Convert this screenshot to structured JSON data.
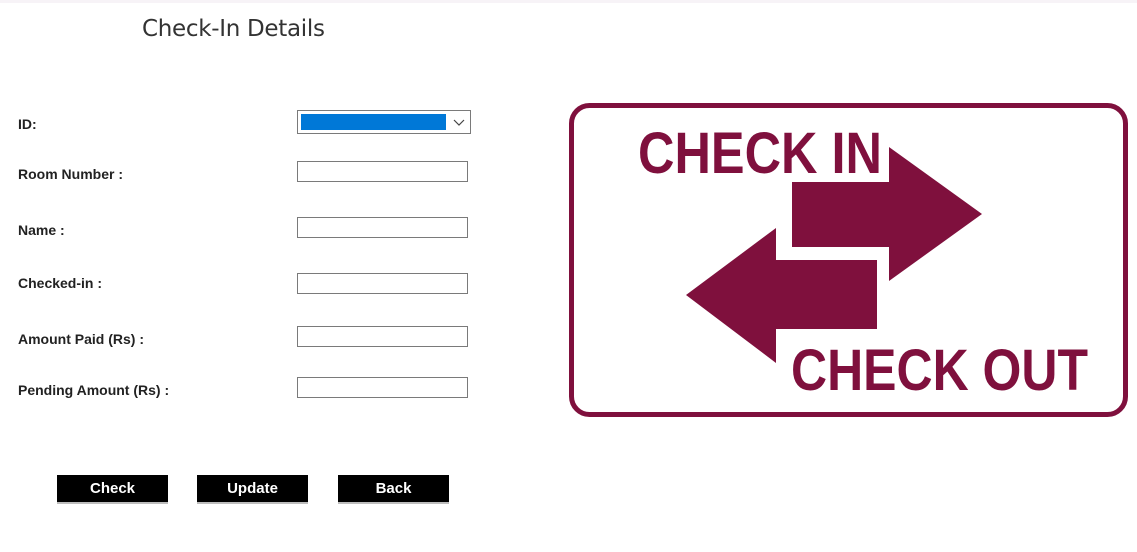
{
  "page": {
    "title": "Check-In Details"
  },
  "form": {
    "id_label": "ID:",
    "id_value": "",
    "room_label": "Room Number :",
    "room_value": "",
    "name_label": "Name :",
    "name_value": "",
    "checkedin_label": "Checked-in :",
    "checkedin_value": "",
    "amount_label": "Amount Paid (Rs) :",
    "amount_value": "",
    "pending_label": "Pending Amount (Rs) :",
    "pending_value": ""
  },
  "buttons": {
    "check": "Check",
    "update": "Update",
    "back": "Back"
  },
  "sign": {
    "top_text": "CHECK IN",
    "bottom_text": "CHECK OUT",
    "color": "#7f103d"
  },
  "colors": {
    "selection": "#0078d7",
    "button_bg": "#000000"
  }
}
